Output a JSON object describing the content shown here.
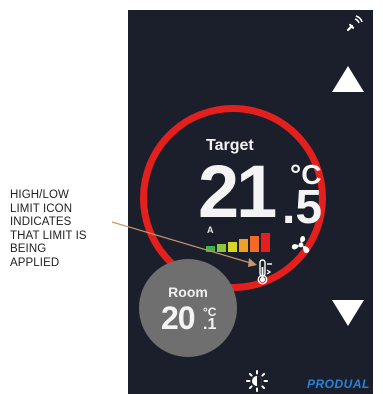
{
  "annotation": {
    "lines": [
      "HIGH/LOW",
      "LIMIT ICON",
      "INDICATES",
      "THAT LIMIT IS",
      "BEING",
      "APPLIED"
    ]
  },
  "thermostat": {
    "target_label": "Target",
    "target_integer": "21",
    "target_decimal": ".5",
    "unit": "°C",
    "fan_mode": "A",
    "fan_level_colors": [
      "#3cb44b",
      "#8cc63f",
      "#d6d628",
      "#f0a02a",
      "#f26a28",
      "#e3201d"
    ],
    "room_label": "Room",
    "room_integer": "20",
    "room_decimal": ".1",
    "room_unit": "°C",
    "ring_color": "#e3201d"
  },
  "icons": {
    "up": "arrow-up-icon",
    "down": "arrow-down-icon",
    "gps": "gps-signal-icon",
    "fan": "fan-icon",
    "limit": "thermometer-limit-icon",
    "brightness": "brightness-icon"
  },
  "brand": "PRODUAL"
}
